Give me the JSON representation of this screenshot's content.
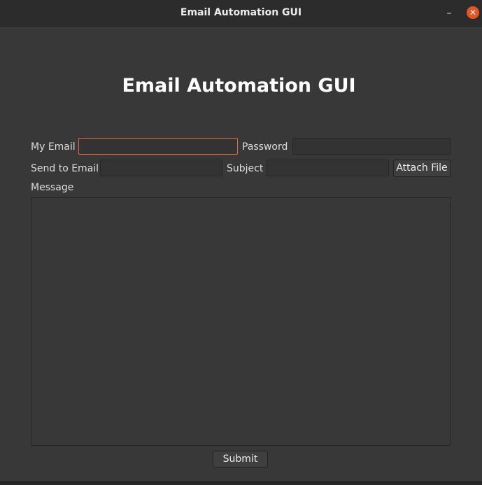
{
  "window": {
    "title": "Email Automation GUI",
    "minimize_glyph": "–",
    "close_glyph": "✕",
    "close_color": "#e95420"
  },
  "main": {
    "heading": "Email Automation GUI",
    "my_email_label": "My Email",
    "my_email_value": "",
    "password_label": "Password",
    "password_value": "",
    "send_to_label": "Send to Email",
    "send_to_value": "",
    "subject_label": "Subject",
    "subject_value": "",
    "attach_button_label": "Attach File",
    "message_label": "Message",
    "message_value": "",
    "submit_button_label": "Submit",
    "focus_color": "#e6693d"
  }
}
